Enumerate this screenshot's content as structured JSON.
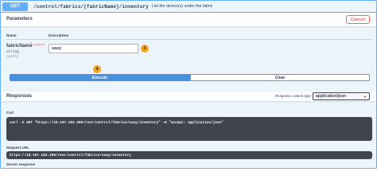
{
  "operation": {
    "method": "GET",
    "path": "/control/fabrics/{fabricName}/inventory",
    "description": "List the device(s) under the fabric"
  },
  "parameters_section": {
    "title": "Parameters",
    "cancel_label": "Cancel",
    "col_name": "Name",
    "col_description": "Description"
  },
  "parameter": {
    "name": "fabricName",
    "star": "*",
    "required_label": "required",
    "type": "string",
    "location": "(path)",
    "value": "easy"
  },
  "annotations": {
    "step_3": "3",
    "step_4": "4"
  },
  "actions": {
    "execute_label": "Execute",
    "clear_label": "Clear"
  },
  "responses_section": {
    "title": "Responses",
    "content_type_label": "Response content type",
    "content_type_value": "application/json"
  },
  "curl": {
    "label": "Curl",
    "command": "curl -X GET \"https://10.107.183.209/rest/control/fabrics/easy/inventory\" -H \"accept: application/json\""
  },
  "request_url": {
    "label": "Request URL",
    "value": "https://10.107.183.209/rest/control/fabrics/easy/inventory"
  },
  "server_response": {
    "label": "Server response"
  },
  "colors": {
    "get_blue": "#61affe",
    "execute_blue": "#4990e2",
    "cancel_red": "#ff6060",
    "badge_orange": "#f5a623",
    "code_bg": "#41444e"
  }
}
